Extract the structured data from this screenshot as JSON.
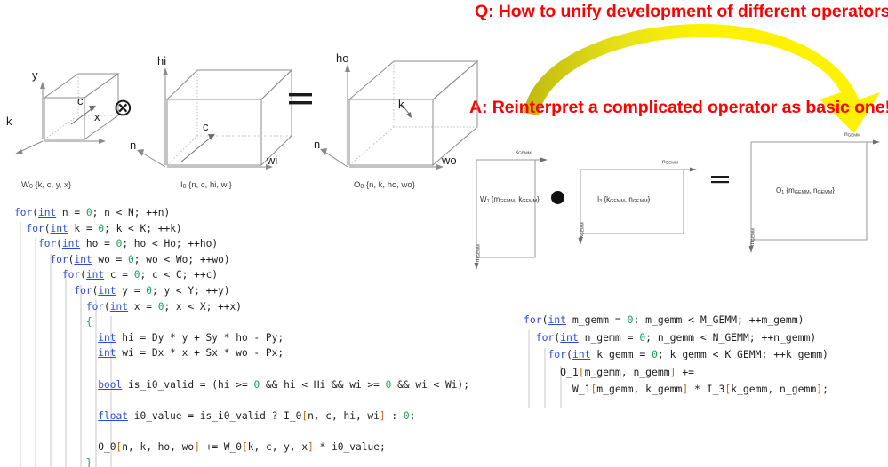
{
  "banner": {
    "question": "Q: How to unify development of different operators?",
    "answer": "A: Reinterpret a complicated operator as basic one!",
    "text_color": "#FF0000",
    "arrow_color": "#FFF200",
    "arrow_shade_color": "#C8C414"
  },
  "tensor_diagram": {
    "weight": {
      "caption_name": "W",
      "caption_sub": "0",
      "caption_dims": " {k, c, y, x}",
      "axes": {
        "up": "y",
        "right": "x",
        "depth_left": "k",
        "depth_diag": "c"
      }
    },
    "input": {
      "caption_name": "I",
      "caption_sub": "0",
      "caption_dims": " {n, c, hi, wi}",
      "axes": {
        "up": "hi",
        "right": "wi",
        "depth_left": "n",
        "depth_diag": "c"
      }
    },
    "output": {
      "caption_name": "O",
      "caption_sub": "0",
      "caption_dims": " {n, k, ho, wo}",
      "axes": {
        "up": "ho",
        "right": "wo",
        "depth_left": "n",
        "depth_diag": "k"
      }
    },
    "operators": {
      "multiply": "⊗",
      "equals": "="
    }
  },
  "matrix_diagram": {
    "weight": {
      "label_name": "W",
      "label_sub": "1",
      "label_dims": " {m",
      "label_sub2": "GEMM",
      "label_mid": ", k",
      "label_sub3": "GEMM",
      "label_end": "}",
      "axis_top": "k",
      "axis_top_sub": "GEMM",
      "axis_left": "m",
      "axis_left_sub": "GEMM"
    },
    "input": {
      "label_name": "I",
      "label_sub": "3",
      "label_dims": " {k",
      "label_sub2": "GEMM",
      "label_mid": ", n",
      "label_sub3": "GEMM",
      "label_end": "}",
      "axis_top": "n",
      "axis_top_sub": "GEMM",
      "axis_left": "k",
      "axis_left_sub": "GEMM"
    },
    "output": {
      "label_name": "O",
      "label_sub": "1",
      "label_dims": " {m",
      "label_sub2": "GEMM",
      "label_mid": ", n",
      "label_sub3": "GEMM",
      "label_end": "}",
      "axis_top": "n",
      "axis_top_sub": "GEMM",
      "axis_left": "m",
      "axis_left_sub": "GEMM"
    },
    "operators": {
      "dot": "●",
      "equals": "="
    }
  },
  "conv_code": {
    "lines": [
      "for(int n = 0; n < N; ++n)",
      "  for(int k = 0; k < K; ++k)",
      "    for(int ho = 0; ho < Ho; ++ho)",
      "      for(int wo = 0; wo < Wo; ++wo)",
      "        for(int c = 0; c < C; ++c)",
      "          for(int y = 0; y < Y; ++y)",
      "            for(int x = 0; x < X; ++x)",
      "            {",
      "              int hi = Dy * y + Sy * ho - Py;",
      "              int wi = Dx * x + Sx * wo - Px;",
      "",
      "              bool is_i0_valid = (hi >= 0 && hi < Hi && wi >= 0 && wi < Wi);",
      "",
      "              float i0_value = is_i0_valid ? I_0[n, c, hi, wi] : 0;",
      "",
      "              O_0[n, k, ho, wo] += W_0[k, c, y, x] * i0_value;",
      "            }"
    ]
  },
  "gemm_code": {
    "lines": [
      "for(int m_gemm = 0; m_gemm < M_GEMM; ++m_gemm)",
      "  for(int n_gemm = 0; n_gemm < N_GEMM; ++n_gemm)",
      "    for(int k_gemm = 0; k_gemm < K_GEMM; ++k_gemm)",
      "      O_1[m_gemm, n_gemm] +=",
      "        W_1[m_gemm, k_gemm] * I_3[k_gemm, n_gemm];"
    ]
  }
}
